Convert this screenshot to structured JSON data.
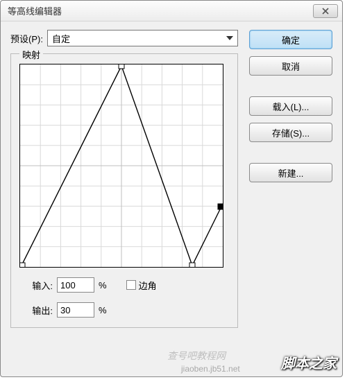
{
  "title": "等高线编辑器",
  "preset": {
    "label": "预设(P):",
    "value": "自定"
  },
  "fieldset_legend": "映射",
  "input": {
    "label": "输入:",
    "value": "100",
    "unit": "%"
  },
  "output": {
    "label": "输出:",
    "value": "30",
    "unit": "%"
  },
  "corner": {
    "label": "边角"
  },
  "buttons": {
    "ok": "确定",
    "cancel": "取消",
    "load": "载入(L)...",
    "save": "存储(S)...",
    "new": "新建..."
  },
  "watermark": "脚本之家",
  "watermark2": "jiaoben.jb51.net",
  "watermark3": "查号吧教程网",
  "chart_data": {
    "type": "line",
    "x_range": [
      0,
      100
    ],
    "y_range": [
      0,
      100
    ],
    "title": "",
    "xlabel": "",
    "ylabel": "",
    "points": [
      {
        "x": 0,
        "y": 0
      },
      {
        "x": 50,
        "y": 100
      },
      {
        "x": 85,
        "y": 0
      },
      {
        "x": 100,
        "y": 30
      }
    ],
    "selected_point_index": 3
  }
}
